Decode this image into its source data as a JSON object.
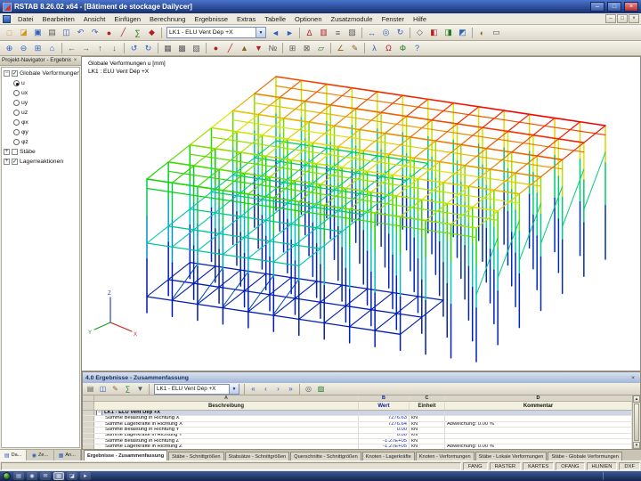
{
  "window": {
    "title": "RSTAB 8.26.02 x64 - [Bâtiment de stockage Dailycer]",
    "minimize_glyph": "–",
    "maximize_glyph": "□",
    "close_glyph": "×"
  },
  "mdi": {
    "minimize_glyph": "–",
    "restore_glyph": "□",
    "close_glyph": "×"
  },
  "menu": {
    "items": [
      "Datei",
      "Bearbeiten",
      "Ansicht",
      "Einfügen",
      "Berechnung",
      "Ergebnisse",
      "Extras",
      "Tabelle",
      "Optionen",
      "Zusatzmodule",
      "Fenster",
      "Hilfe"
    ]
  },
  "toolbars": {
    "case_combo": "LK1 - ELU Vent Dép +X",
    "dropdown_glyph": "▼",
    "row1_left": [
      {
        "name": "new-project-button",
        "glyph": "□",
        "color": "#d79424"
      },
      {
        "name": "open-project-button",
        "glyph": "◪",
        "color": "#d79424"
      },
      {
        "name": "save-button",
        "glyph": "▣",
        "color": "#2b5fc0"
      },
      {
        "name": "print-button",
        "glyph": "▤",
        "color": "#5a5a5a"
      },
      {
        "name": "copy-button",
        "glyph": "◫",
        "color": "#2b5fc0"
      },
      {
        "name": "undo-button",
        "glyph": "↶",
        "color": "#2b5fc0"
      },
      {
        "name": "redo-button",
        "glyph": "↷",
        "color": "#2b5fc0"
      },
      {
        "name": "new-node-button",
        "glyph": "●",
        "color": "#b22222"
      },
      {
        "name": "new-member-button",
        "glyph": "╱",
        "color": "#b22222"
      },
      {
        "name": "calculation-button",
        "glyph": "∑",
        "color": "#1f7a1f"
      },
      {
        "name": "results-toggle-button",
        "glyph": "◆",
        "color": "#b22222"
      },
      {
        "sep": true
      }
    ],
    "row1_right": [
      {
        "name": "prev-loadcase-button",
        "glyph": "◄",
        "color": "#2b5fc0"
      },
      {
        "name": "next-loadcase-button",
        "glyph": "►",
        "color": "#2b5fc0"
      },
      {
        "sep": true
      },
      {
        "name": "show-deformation-button",
        "glyph": "Δ",
        "color": "#b22222"
      },
      {
        "name": "result-diagrams-button",
        "glyph": "▥",
        "color": "#b22222"
      },
      {
        "name": "result-values-button",
        "glyph": "≡",
        "color": "#5a5a5a"
      },
      {
        "name": "print-graphic-button",
        "glyph": "▨",
        "color": "#5a5a5a"
      },
      {
        "sep": true
      },
      {
        "name": "move-view-button",
        "glyph": "↔",
        "color": "#2b5fc0"
      },
      {
        "name": "zoom-view-button",
        "glyph": "◎",
        "color": "#2b5fc0"
      },
      {
        "name": "rotate-view-button",
        "glyph": "↻",
        "color": "#2b5fc0"
      },
      {
        "sep": true
      },
      {
        "name": "isometric-view-button",
        "glyph": "◇",
        "color": "#5a5a5a"
      },
      {
        "name": "view-x-button",
        "glyph": "◧",
        "color": "#b22222"
      },
      {
        "name": "view-y-button",
        "glyph": "◨",
        "color": "#1f7a1f"
      },
      {
        "name": "view-z-button",
        "glyph": "◩",
        "color": "#2b5fc0"
      },
      {
        "sep": true
      },
      {
        "name": "visibility-button",
        "glyph": "◐",
        "color": "#8a6a1a"
      },
      {
        "name": "clipping-plane-button",
        "glyph": "▭",
        "color": "#5a5a5a"
      }
    ],
    "row2": [
      {
        "name": "zoom-in-button",
        "glyph": "⊕",
        "color": "#2b5fc0"
      },
      {
        "name": "zoom-out-button",
        "glyph": "⊖",
        "color": "#2b5fc0"
      },
      {
        "name": "zoom-window-button",
        "glyph": "⊞",
        "color": "#2b5fc0"
      },
      {
        "name": "fit-view-button",
        "glyph": "⌂",
        "color": "#2b5fc0"
      },
      {
        "sep": true
      },
      {
        "name": "pan-left-button",
        "glyph": "←",
        "color": "#5a5a5a"
      },
      {
        "name": "pan-right-button",
        "glyph": "→",
        "color": "#5a5a5a"
      },
      {
        "name": "pan-up-button",
        "glyph": "↑",
        "color": "#5a5a5a"
      },
      {
        "name": "pan-down-button",
        "glyph": "↓",
        "color": "#5a5a5a"
      },
      {
        "sep": true
      },
      {
        "name": "rotate-left-button",
        "glyph": "↺",
        "color": "#2b5fc0"
      },
      {
        "name": "rotate-right-button",
        "glyph": "↻",
        "color": "#2b5fc0"
      },
      {
        "sep": true
      },
      {
        "name": "wireframe-mode-button",
        "glyph": "▦",
        "color": "#5a5a5a"
      },
      {
        "name": "solid-mode-button",
        "glyph": "▩",
        "color": "#5a5a5a"
      },
      {
        "name": "transparent-mode-button",
        "glyph": "▧",
        "color": "#5a5a5a"
      },
      {
        "sep": true
      },
      {
        "name": "show-nodes-button",
        "glyph": "●",
        "color": "#b22222"
      },
      {
        "name": "show-members-button",
        "glyph": "╱",
        "color": "#b22222"
      },
      {
        "name": "show-supports-button",
        "glyph": "▲",
        "color": "#8a6a1a"
      },
      {
        "name": "show-loads-button",
        "glyph": "▼",
        "color": "#b22222"
      },
      {
        "name": "show-numbering-button",
        "glyph": "№",
        "color": "#5a5a5a"
      },
      {
        "sep": true
      },
      {
        "name": "grid-toggle-button",
        "glyph": "⊞",
        "color": "#5a5a5a"
      },
      {
        "name": "snap-toggle-button",
        "glyph": "⊠",
        "color": "#5a5a5a"
      },
      {
        "name": "work-plane-button",
        "glyph": "▱",
        "color": "#1f7a1f"
      },
      {
        "sep": true
      },
      {
        "name": "dimensions-button",
        "glyph": "∠",
        "color": "#8a6a1a"
      },
      {
        "name": "comments-button",
        "glyph": "✎",
        "color": "#8a6a1a"
      },
      {
        "sep": true
      },
      {
        "name": "modules-button",
        "glyph": "λ",
        "color": "#2b5fc0"
      },
      {
        "name": "dynamics-button",
        "glyph": "Ω",
        "color": "#b22222"
      },
      {
        "name": "stability-button",
        "glyph": "Φ",
        "color": "#1f7a1f"
      },
      {
        "name": "help-button",
        "glyph": "?",
        "color": "#2b5fc0"
      }
    ]
  },
  "navigator": {
    "title": "Projekt-Navigator - Ergebnisse",
    "close_glyph": "×",
    "tree": [
      {
        "type": "group",
        "label": "Globale Verformungen",
        "expander": "minus",
        "checked": true
      },
      {
        "type": "option",
        "label": "u",
        "selected": true
      },
      {
        "type": "option",
        "label": "ux",
        "selected": false
      },
      {
        "type": "option",
        "label": "uy",
        "selected": false
      },
      {
        "type": "option",
        "label": "uz",
        "selected": false
      },
      {
        "type": "option",
        "label": "φx",
        "selected": false
      },
      {
        "type": "option",
        "label": "φy",
        "selected": false
      },
      {
        "type": "option",
        "label": "φz",
        "selected": false
      },
      {
        "type": "group",
        "label": "Stäbe",
        "expander": "plus",
        "checked": false
      },
      {
        "type": "group",
        "label": "Lagerreaktionen",
        "expander": "plus",
        "checked": true
      }
    ],
    "tabs": [
      {
        "label": "Da...",
        "glyph": "▤"
      },
      {
        "label": "Ze...",
        "glyph": "◉"
      },
      {
        "label": "An...",
        "glyph": "▦"
      }
    ]
  },
  "viewport": {
    "label_line1": "Globale Verformungen u [mm]",
    "label_line2": "LK1 : ELU Vent Dép +X",
    "axes": {
      "x": "X",
      "y": "Y",
      "z": "Z",
      "x_color": "#cc2222",
      "y_color": "#1f9a1f",
      "z_color": "#2244cc"
    }
  },
  "results_panel": {
    "title": "4.0 Ergebnisse - Zusammenfassung",
    "close_glyph": "×",
    "combo_value": "LK1 - ELU Vent Dép +X",
    "dropdown_glyph": "▼",
    "scrollbar": {
      "up": "▲",
      "down": "▼"
    },
    "toolbar_left": [
      {
        "name": "table-settings-button",
        "glyph": "▤",
        "color": "#5a5a5a"
      },
      {
        "name": "table-copy-button",
        "glyph": "◫",
        "color": "#2b5fc0"
      },
      {
        "name": "table-edit-button",
        "glyph": "✎",
        "color": "#8a6a1a"
      },
      {
        "name": "table-sum-button",
        "glyph": "∑",
        "color": "#1f7a1f"
      },
      {
        "name": "table-filter-button",
        "glyph": "▼",
        "color": "#5a5a5a"
      },
      {
        "sep": true
      }
    ],
    "toolbar_right": [
      {
        "sep": true
      },
      {
        "name": "first-loadcase-button",
        "glyph": "«",
        "color": "#2b5fc0"
      },
      {
        "name": "prev-loadcase-table-button",
        "glyph": "‹",
        "color": "#2b5fc0"
      },
      {
        "name": "next-loadcase-table-button",
        "glyph": "›",
        "color": "#2b5fc0"
      },
      {
        "name": "last-loadcase-button",
        "glyph": "»",
        "color": "#2b5fc0"
      },
      {
        "sep": true
      },
      {
        "name": "table-search-button",
        "glyph": "◎",
        "color": "#5a5a5a"
      },
      {
        "name": "table-export-button",
        "glyph": "▨",
        "color": "#1f7a1f"
      }
    ],
    "columns": {
      "letters": [
        "A",
        "B",
        "C",
        "D"
      ],
      "headers": [
        "Beschreibung",
        "Wert",
        "Einheit",
        "Kommentar"
      ]
    },
    "group_collapse_glyph": "−",
    "rows": [
      {
        "group": true,
        "description": "LK1 - ELU Vent Dép +X",
        "wert": "",
        "einheit": "",
        "kommentar": ""
      },
      {
        "group": false,
        "description": "Summe Belastung in Richtung X",
        "wert": "7276.63",
        "einheit": "kN",
        "kommentar": ""
      },
      {
        "group": false,
        "description": "Summe Lagerkräfte in Richtung X",
        "wert": "7276.64",
        "einheit": "kN",
        "kommentar": "Abweichung: 0.00 %"
      },
      {
        "group": false,
        "description": "Summe Belastung in Richtung Y",
        "wert": "0.00",
        "einheit": "kN",
        "kommentar": ""
      },
      {
        "group": false,
        "description": "Summe Lagerkräfte in Richtung Y",
        "wert": "0.00",
        "einheit": "kN",
        "kommentar": ""
      },
      {
        "group": false,
        "description": "Summe Belastung in Richtung Z",
        "wert": "-1.27E+05",
        "einheit": "kN",
        "kommentar": ""
      },
      {
        "group": false,
        "description": "Summe Lagerkräfte in Richtung Z",
        "wert": "-1.27E+05",
        "einheit": "kN",
        "kommentar": "Abweichung: 0.00 %"
      }
    ]
  },
  "table_tabs": [
    {
      "label": "Ergebnisse - Zusammenfassung",
      "active": true
    },
    {
      "label": "Stäbe - Schnittgrößen",
      "active": false
    },
    {
      "label": "Stabsätze - Schnittgrößen",
      "active": false
    },
    {
      "label": "Querschnitte - Schnittgrößen",
      "active": false
    },
    {
      "label": "Knoten - Lagerkräfte",
      "active": false
    },
    {
      "label": "Knoten - Verformungen",
      "active": false
    },
    {
      "label": "Stäbe - Lokale Verformungen",
      "active": false
    },
    {
      "label": "Stäbe - Globale Verformungen",
      "active": false
    }
  ],
  "status_bar": {
    "hint": "",
    "toggles": [
      "FANG",
      "RASTER",
      "KARTES",
      "OFANG",
      "HLINIEN",
      "DXF"
    ]
  },
  "taskbar": {
    "icons": [
      {
        "name": "taskbar-item-explorer",
        "glyph": "▤",
        "active": false
      },
      {
        "name": "taskbar-item-browser",
        "glyph": "◉",
        "active": false
      },
      {
        "name": "taskbar-item-mail",
        "glyph": "✉",
        "active": false
      },
      {
        "name": "taskbar-item-rstab",
        "glyph": "▦",
        "active": true
      },
      {
        "name": "taskbar-item-folder",
        "glyph": "◪",
        "active": false
      },
      {
        "name": "taskbar-item-media",
        "glyph": "►",
        "active": false
      }
    ]
  }
}
